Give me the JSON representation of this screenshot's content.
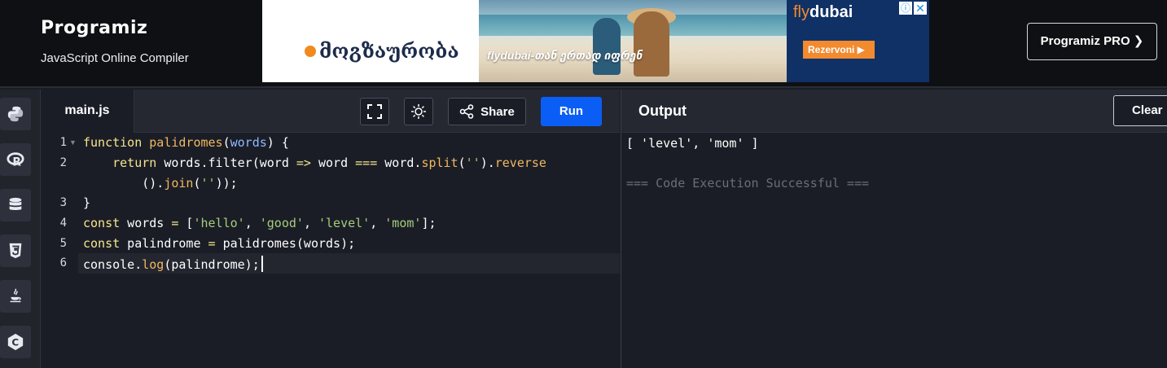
{
  "header": {
    "brand": "Programiz",
    "subtitle": "JavaScript Online Compiler",
    "pro_button": "Programiz PRO ❯"
  },
  "ad": {
    "headline": "მოგზაურობა",
    "slogan": "flydubai-თან ერთად იფრენ",
    "brand_left": "fly",
    "brand_right": "dubai",
    "cta": "Rezervoni ▶",
    "info": "ⓘ",
    "close": "✕"
  },
  "sidebar": {
    "items": [
      {
        "name": "python-icon"
      },
      {
        "name": "r-icon"
      },
      {
        "name": "sql-icon"
      },
      {
        "name": "html5-icon"
      },
      {
        "name": "java-icon"
      },
      {
        "name": "c-icon"
      }
    ]
  },
  "editor": {
    "tab": "main.js",
    "share_label": "Share",
    "run_label": "Run",
    "line_numbers": [
      "1",
      "2",
      "3",
      "4",
      "5",
      "6"
    ],
    "lines": [
      [
        {
          "t": "function ",
          "c": "kw"
        },
        {
          "t": "palidromes",
          "c": "fn"
        },
        {
          "t": "(",
          "c": ""
        },
        {
          "t": "words",
          "c": "pm"
        },
        {
          "t": ") {",
          "c": ""
        }
      ],
      [
        {
          "t": "    ",
          "c": ""
        },
        {
          "t": "return",
          "c": "kw"
        },
        {
          "t": " words.filter(word ",
          "c": ""
        },
        {
          "t": "=>",
          "c": "kw"
        },
        {
          "t": " word ",
          "c": ""
        },
        {
          "t": "===",
          "c": "kw"
        },
        {
          "t": " word.",
          "c": ""
        },
        {
          "t": "split",
          "c": "fn"
        },
        {
          "t": "(",
          "c": ""
        },
        {
          "t": "''",
          "c": "str"
        },
        {
          "t": ").",
          "c": ""
        },
        {
          "t": "reverse",
          "c": "fn"
        }
      ],
      [
        {
          "t": "        ().",
          "c": ""
        },
        {
          "t": "join",
          "c": "fn"
        },
        {
          "t": "(",
          "c": ""
        },
        {
          "t": "''",
          "c": "str"
        },
        {
          "t": "));",
          "c": ""
        }
      ],
      [
        {
          "t": "}",
          "c": ""
        }
      ],
      [
        {
          "t": "const",
          "c": "kw"
        },
        {
          "t": " words ",
          "c": ""
        },
        {
          "t": "=",
          "c": "kw"
        },
        {
          "t": " [",
          "c": ""
        },
        {
          "t": "'hello'",
          "c": "str"
        },
        {
          "t": ", ",
          "c": ""
        },
        {
          "t": "'good'",
          "c": "str"
        },
        {
          "t": ", ",
          "c": ""
        },
        {
          "t": "'level'",
          "c": "str"
        },
        {
          "t": ", ",
          "c": ""
        },
        {
          "t": "'mom'",
          "c": "str"
        },
        {
          "t": "];",
          "c": ""
        }
      ],
      [
        {
          "t": "const",
          "c": "kw"
        },
        {
          "t": " palindrome ",
          "c": ""
        },
        {
          "t": "=",
          "c": "kw"
        },
        {
          "t": " palidromes(words);",
          "c": ""
        }
      ],
      [
        {
          "t": "console.",
          "c": ""
        },
        {
          "t": "log",
          "c": "fn"
        },
        {
          "t": "(palindrome);",
          "c": ""
        }
      ]
    ]
  },
  "output": {
    "title": "Output",
    "clear_label": "Clear",
    "result": "[ 'level', 'mom' ]",
    "status": "=== Code Execution Successful ==="
  },
  "colors": {
    "run_button": "#0b5ef5",
    "background": "#1b1d26",
    "keyword": "#f6e58d",
    "string": "#a4cd7a",
    "param": "#8eb9ff"
  }
}
